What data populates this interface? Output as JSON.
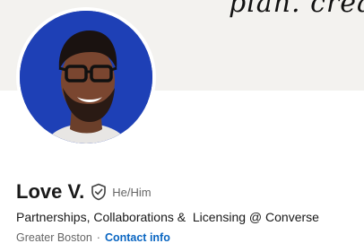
{
  "banner": {
    "text": "plan. create"
  },
  "profile": {
    "name": "Love V.",
    "pronouns": "He/Him",
    "headline": "Partnerships, Collaborations &  Licensing @ Converse",
    "location": "Greater Boston",
    "separator": "·",
    "contact_label": "Contact info"
  },
  "colors": {
    "link": "#0a66c2",
    "avatar_bg": "#1a3aa8",
    "banner_bg": "#f3f2ef"
  },
  "icons": {
    "verified": "verified-shield-icon"
  }
}
